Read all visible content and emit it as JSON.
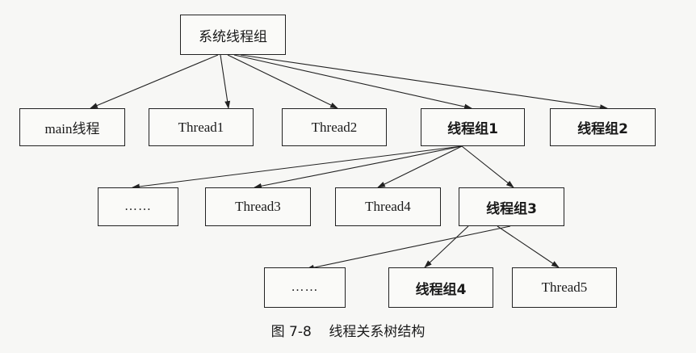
{
  "nodes": {
    "system_group": "系统线程组",
    "main_thread": "main线程",
    "thread1": "Thread1",
    "thread2": "Thread2",
    "group1": "线程组1",
    "group2": "线程组2",
    "ellipsis1": "……",
    "thread3": "Thread3",
    "thread4": "Thread4",
    "group3": "线程组3",
    "ellipsis2": "……",
    "group4": "线程组4",
    "thread5": "Thread5"
  },
  "caption": "图 7-8    线程关系树结构"
}
